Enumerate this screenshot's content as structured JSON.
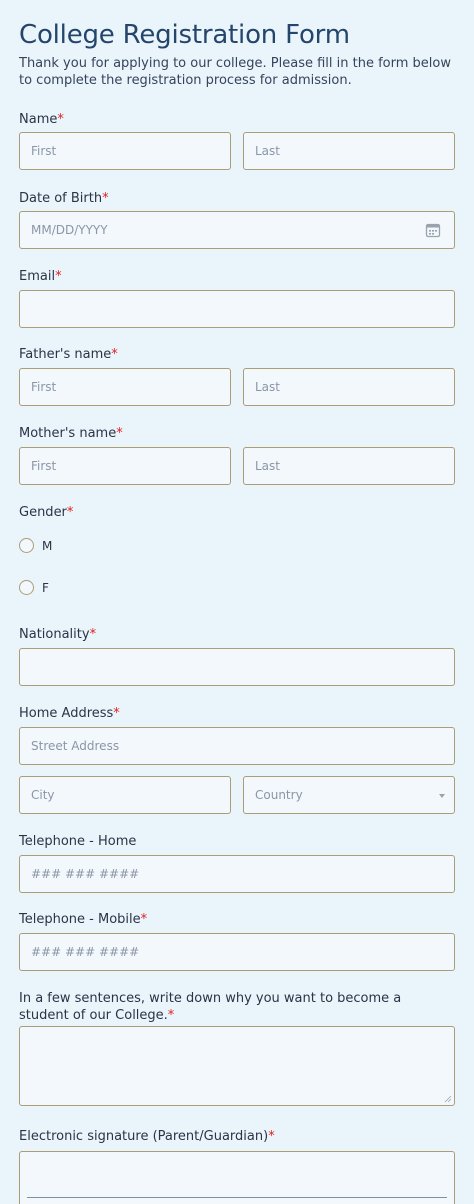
{
  "form": {
    "title": "College Registration Form",
    "subtitle": "Thank you for applying to our college. Please fill in the form below to complete the registration process for admission.",
    "required_mark": "*"
  },
  "name": {
    "label": "Name",
    "first_placeholder": "First",
    "last_placeholder": "Last"
  },
  "dob": {
    "label": "Date of Birth",
    "placeholder": "MM/DD/YYYY",
    "icon": "calendar-icon"
  },
  "email": {
    "label": "Email",
    "placeholder": ""
  },
  "father": {
    "label": "Father's name",
    "first_placeholder": "First",
    "last_placeholder": "Last"
  },
  "mother": {
    "label": "Mother's name",
    "first_placeholder": "First",
    "last_placeholder": "Last"
  },
  "gender": {
    "label": "Gender",
    "options": [
      "M",
      "F"
    ]
  },
  "nationality": {
    "label": "Nationality",
    "placeholder": ""
  },
  "address": {
    "label": "Home Address",
    "street_placeholder": "Street Address",
    "city_placeholder": "City",
    "country_placeholder": "Country"
  },
  "tel_home": {
    "label": "Telephone - Home",
    "placeholder": "### ### ####"
  },
  "tel_mobile": {
    "label": "Telephone - Mobile",
    "placeholder": "### ### ####"
  },
  "why": {
    "label": "In a few sentences, write down why you want to become a student of our College."
  },
  "signature": {
    "label": "Electronic signature (Parent/Guardian)"
  },
  "colors": {
    "accent": "#25466b",
    "border": "#ab9d76",
    "required": "#e02020",
    "background": "#eaf4fb"
  }
}
